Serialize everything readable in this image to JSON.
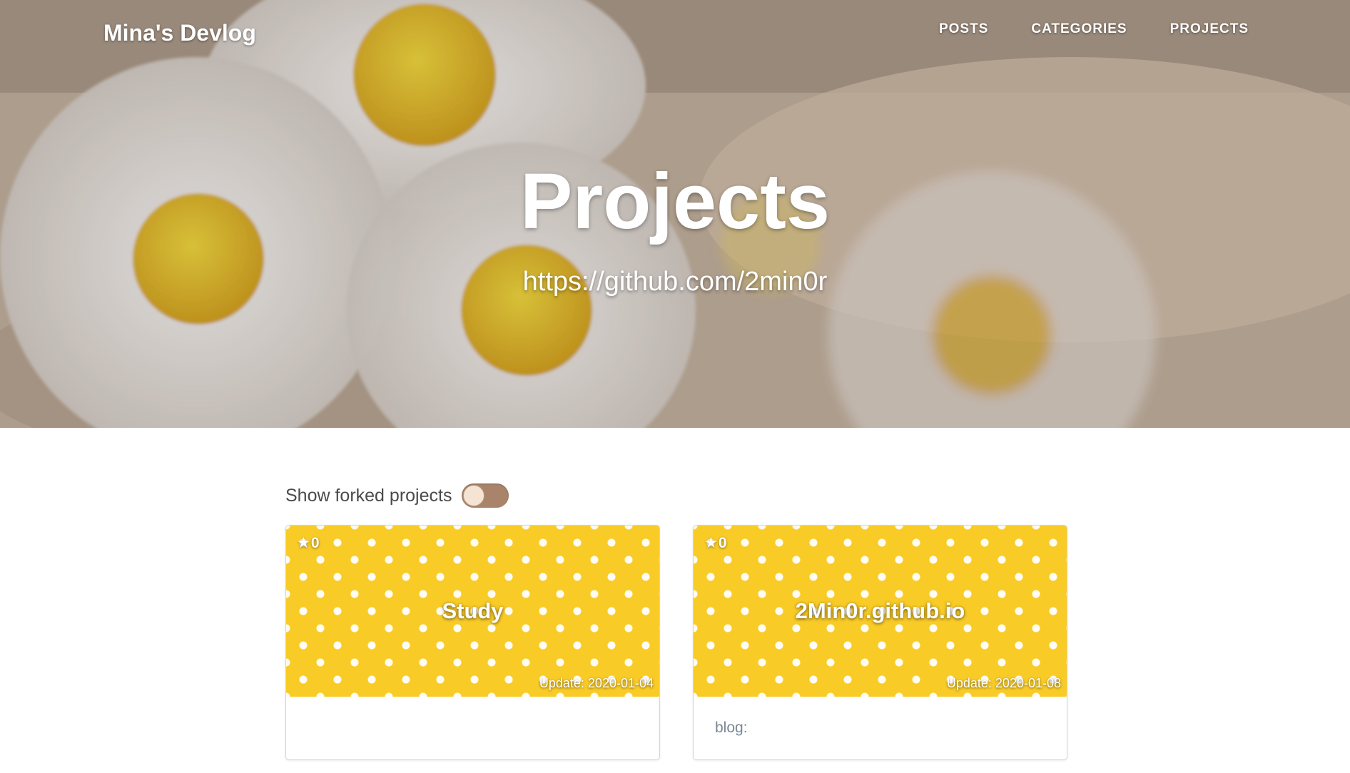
{
  "nav": {
    "brand": "Mina's Devlog",
    "links": [
      "POSTS",
      "CATEGORIES",
      "PROJECTS"
    ]
  },
  "hero": {
    "title": "Projects",
    "subtitle": "https://github.com/2min0r"
  },
  "fork_toggle": {
    "label": "Show forked projects",
    "checked": false
  },
  "projects": [
    {
      "stars": "0",
      "name": "Study",
      "updated": "Update: 2020-01-04",
      "description": ""
    },
    {
      "stars": "0",
      "name": "2Min0r.github.io",
      "updated": "Update: 2020-01-08",
      "description": "blog:"
    }
  ],
  "colors": {
    "card_cover": "#f9cb27",
    "toggle_track": "#a9846a",
    "toggle_knob": "#f5e4d4"
  },
  "icons": {
    "star": "star-icon"
  }
}
